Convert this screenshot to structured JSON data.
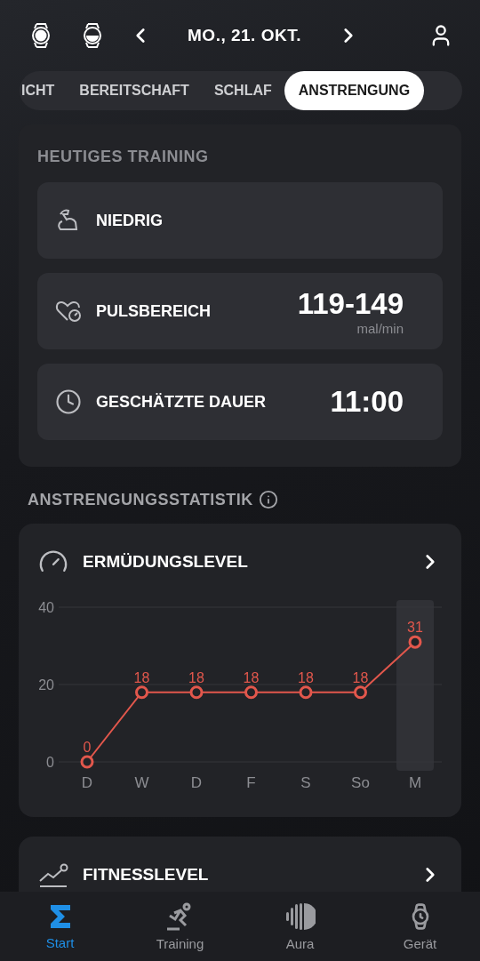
{
  "header": {
    "date": "MO., 21. OKT."
  },
  "tabs": [
    {
      "label": "ICHT",
      "selected": false
    },
    {
      "label": "BEREITSCHAFT",
      "selected": false
    },
    {
      "label": "SCHLAF",
      "selected": false
    },
    {
      "label": "ANSTRENGUNG",
      "selected": true
    }
  ],
  "training": {
    "title": "HEUTIGES TRAINING",
    "rows": [
      {
        "kind": "level",
        "label": "NIEDRIG"
      },
      {
        "kind": "pulse",
        "label": "PULSBEREICH",
        "value": "119-149",
        "unit": "mal/min"
      },
      {
        "kind": "duration",
        "label": "GESCHÄTZTE DAUER",
        "value": "11:00"
      }
    ]
  },
  "stats": {
    "title": "ANSTRENGUNGSSTATISTIK",
    "cards": [
      {
        "kind": "fatigue",
        "title": "ERMÜDUNGSLEVEL",
        "last_day_highlighted": true,
        "chart_data": {
          "type": "line",
          "categories": [
            "D",
            "W",
            "D",
            "F",
            "S",
            "So",
            "M"
          ],
          "series": [
            {
              "color": "#e2574c",
              "marker": "circle",
              "values": [
                0,
                18,
                18,
                18,
                18,
                18,
                31
              ]
            }
          ],
          "ylim": [
            0,
            40
          ],
          "yticks": [
            0,
            20,
            40
          ],
          "data_labels": true
        }
      },
      {
        "kind": "fitness",
        "title": "FITNESSLEVEL"
      }
    ]
  },
  "nav": [
    {
      "kind": "start",
      "label": "Start",
      "selected": true
    },
    {
      "kind": "training",
      "label": "Training",
      "selected": false
    },
    {
      "kind": "aura",
      "label": "Aura",
      "selected": false
    },
    {
      "kind": "device",
      "label": "Gerät",
      "selected": false
    }
  ]
}
